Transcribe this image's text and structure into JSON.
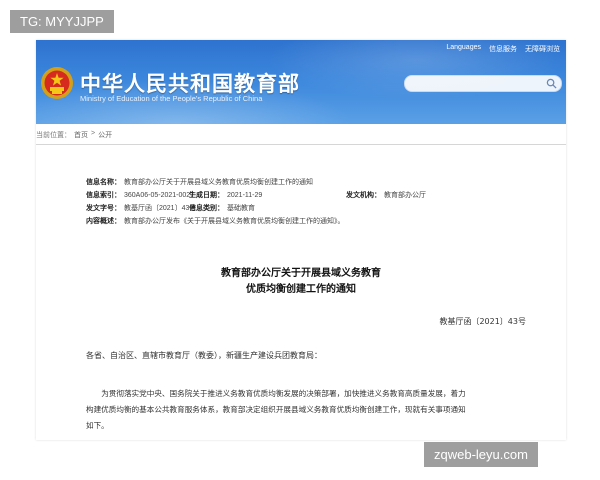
{
  "overlay": {
    "tag_top": "TG: MYYJJPP",
    "tag_bottom": "zqweb-leyu.com"
  },
  "header": {
    "title": "中华人民共和国教育部",
    "subtitle": "Ministry of Education of the People's Republic of China",
    "links": [
      "Languages",
      "信息服务",
      "无障碍浏览"
    ],
    "search": {
      "placeholder": ""
    }
  },
  "breadcrumb": {
    "prefix": "当前位置：",
    "items": [
      "首页",
      ">",
      "公开"
    ]
  },
  "meta": {
    "title_label": "信息名称：",
    "title_value": "教育部办公厅关于开展县域义务教育优质均衡创建工作的通知",
    "index_label": "信息索引：",
    "index_value": "360A06-05-2021-0027-1",
    "date_label": "生成日期：",
    "date_value": "2021-11-29",
    "issuer_label": "发文机构：",
    "issuer_value": "教育部办公厅",
    "docno_label": "发文字号：",
    "docno_value": "教基厅函〔2021〕43号",
    "category_label": "信息类别：",
    "category_value": "基础教育",
    "summary_label": "内容概述：",
    "summary_value": "教育部办公厅发布《关于开展县域义务教育优质均衡创建工作的通知》。"
  },
  "document": {
    "title_line1": "教育部办公厅关于开展县域义务教育",
    "title_line2": "优质均衡创建工作的通知",
    "number": "教基厅函〔2021〕43号",
    "addressee": "各省、自治区、直辖市教育厅（教委），新疆生产建设兵团教育局：",
    "body_line1": "为贯彻落实党中央、国务院关于推进义务教育优质均衡发展的决策部署，加快推进义务教育高质量发展，着力",
    "body_line2": "构建优质均衡的基本公共教育服务体系，教育部决定组织开展县域义务教育优质均衡创建工作，现就有关事项通知",
    "body_line3": "如下。"
  }
}
